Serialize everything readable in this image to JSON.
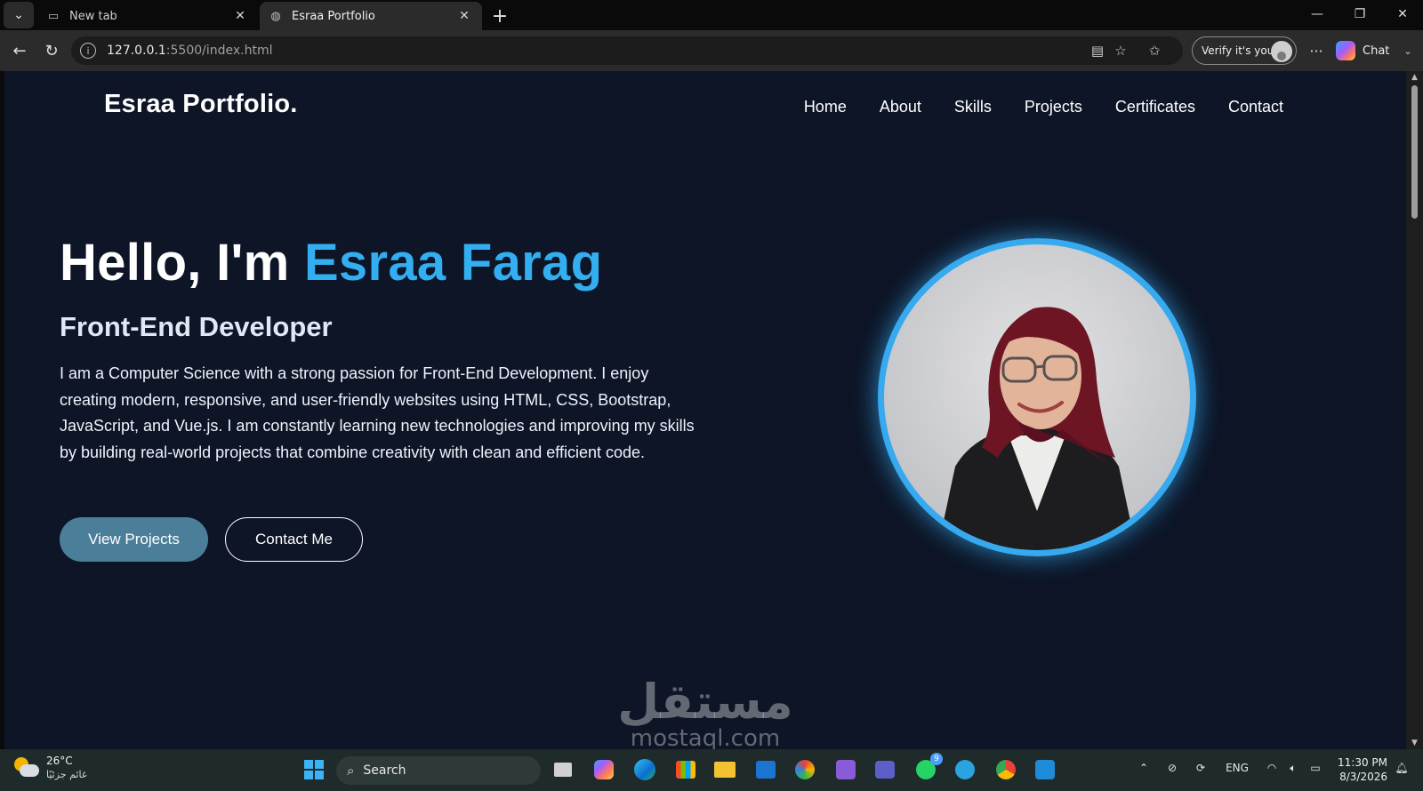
{
  "browser": {
    "tabs": [
      {
        "title": "New tab",
        "icon": "new-tab-page-icon",
        "active": false
      },
      {
        "title": "Esraa Portfolio",
        "icon": "globe-icon",
        "active": true
      }
    ],
    "url_host": "127.0.0.1",
    "url_rest": ":5500/index.html",
    "verify_label": "Verify it's you",
    "chat_label": "Chat"
  },
  "site": {
    "brand": "Esraa Portfolio.",
    "nav": [
      "Home",
      "About",
      "Skills",
      "Projects",
      "Certificates",
      "Contact"
    ],
    "hero": {
      "greeting": "Hello, I'm",
      "name": "Esraa Farag",
      "subtitle": "Front-End Developer",
      "description": "I am a Computer Science with a strong passion for Front-End Development. I enjoy creating modern, responsive, and user-friendly websites using HTML, CSS, Bootstrap, JavaScript, and Vue.js. I am constantly learning new technologies and improving my skills by building real-world projects that combine creativity with clean and efficient code.",
      "primary_button": "View Projects",
      "secondary_button": "Contact Me"
    },
    "colors": {
      "background": "#0d1526",
      "accent": "#33aef0",
      "primary_button": "#4b7f99"
    }
  },
  "watermark": {
    "arabic": "مستقل",
    "latin": "mostaql.com"
  },
  "taskbar": {
    "weather_temp": "26°C",
    "weather_condition": "غائم جزئيًا",
    "search_placeholder": "Search",
    "whatsapp_badge": "9",
    "language": "ENG",
    "time": "11:30 PM",
    "date": "8/3/2026"
  }
}
